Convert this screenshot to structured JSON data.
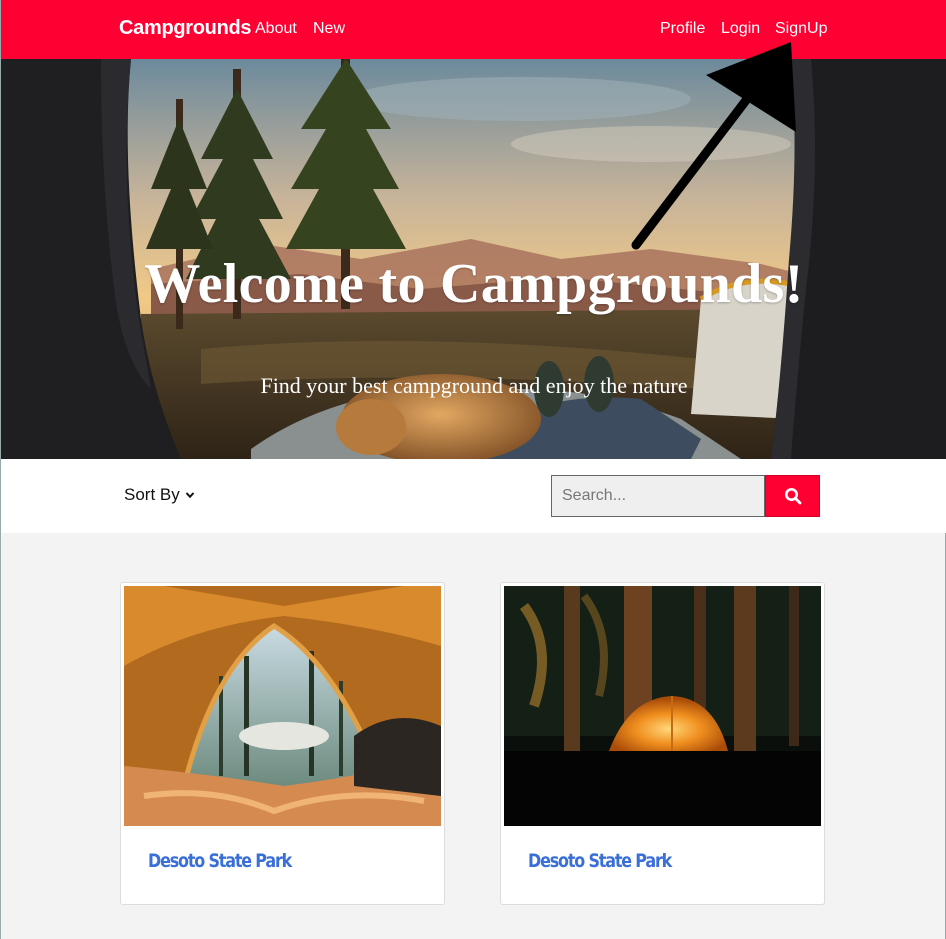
{
  "nav": {
    "brand": "Campgrounds",
    "left_links": [
      "About",
      "New"
    ],
    "right_links": [
      "Profile",
      "Login",
      "SignUp"
    ],
    "background_color": "#ff0033"
  },
  "hero": {
    "title": "Welcome to Campgrounds!",
    "subtitle": "Find your best campground and enjoy the nature"
  },
  "toolbar": {
    "sort_label": "Sort By",
    "sort_icon": "chevron-down-icon",
    "search_placeholder": "Search...",
    "search_icon": "search-icon",
    "accent_color": "#ff0033"
  },
  "cards": [
    {
      "title": "Desoto State Park",
      "image": "tent-interior-view-forest"
    },
    {
      "title": "Desoto State Park",
      "image": "glowing-tent-night-forest"
    }
  ],
  "annotation": {
    "type": "arrow",
    "points_to": "SignUp"
  },
  "colors": {
    "card_title": "#3b6fd8",
    "page_background": "#f3f3f3"
  }
}
